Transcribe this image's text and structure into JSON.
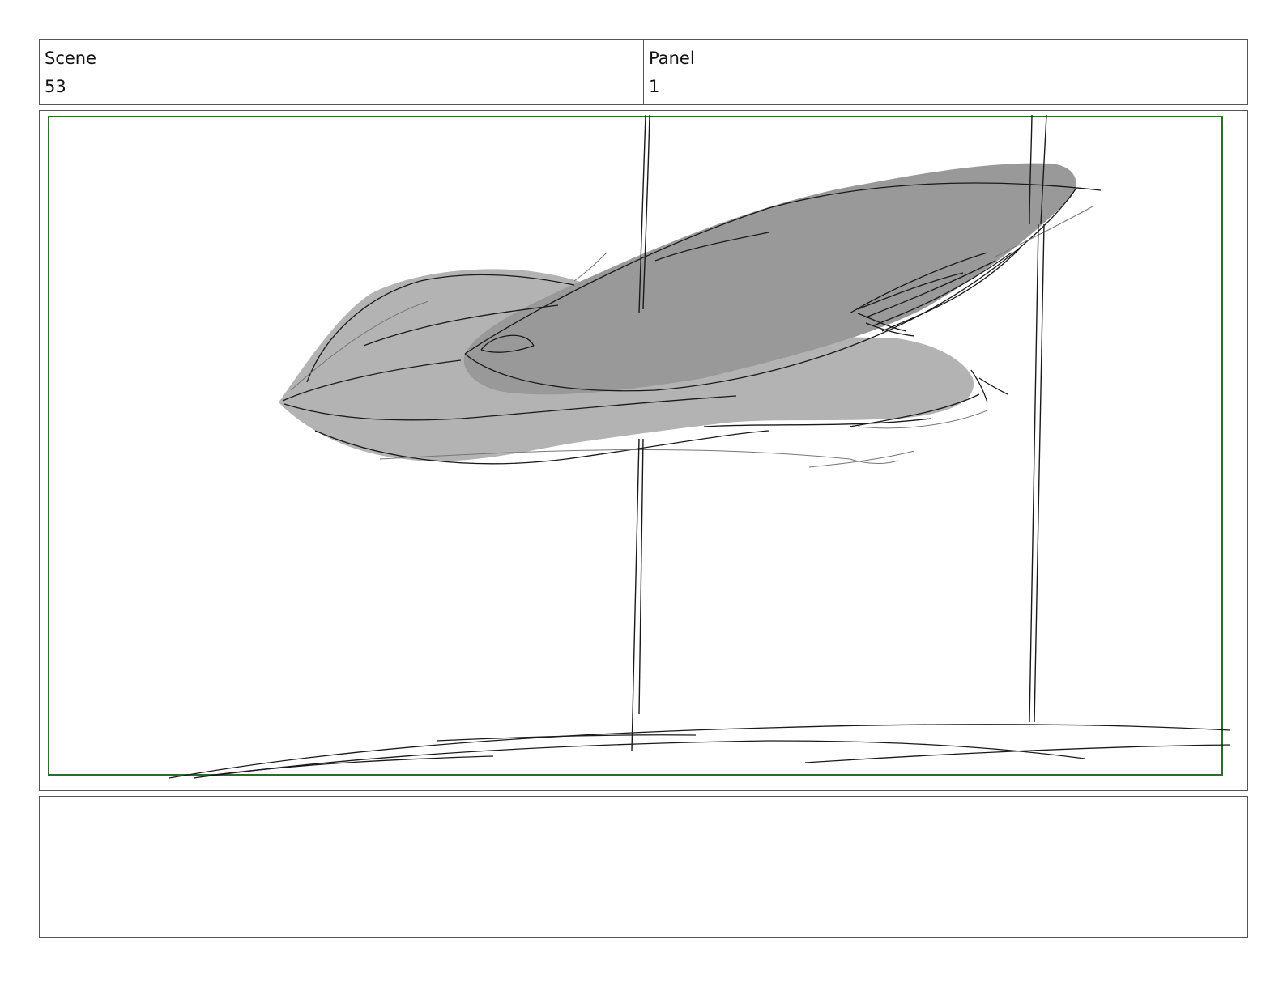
{
  "header": {
    "scene_label": "Scene",
    "scene_value": "53",
    "panel_label": "Panel",
    "panel_value": "1"
  },
  "frame": {
    "safe_area_color": "#2e6b2e",
    "fill_light": "#b3b3b3",
    "fill_dark": "#999999",
    "stroke_color": "#1a1a1a"
  },
  "notes": {
    "text": ""
  }
}
